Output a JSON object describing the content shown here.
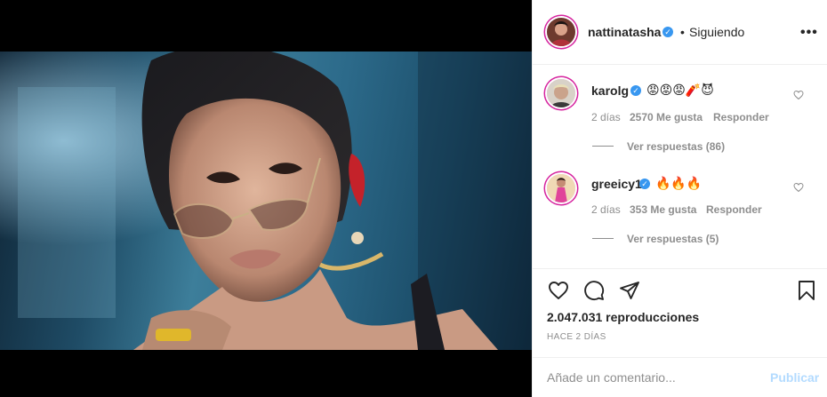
{
  "post": {
    "author": "nattinatasha",
    "follow_separator": "•",
    "follow_status": "Siguiendo",
    "more_label": "•••",
    "verified_mark": "✓"
  },
  "comments": [
    {
      "username": "karolg",
      "text": "😡😡😡🧨😈",
      "time": "2 días",
      "likes": "2570 Me gusta",
      "reply_label": "Responder",
      "view_replies": "Ver respuestas (86)"
    },
    {
      "username": "greeicy1",
      "text": "🔥🔥🔥",
      "time": "2 días",
      "likes": "353 Me gusta",
      "reply_label": "Responder",
      "view_replies": "Ver respuestas (5)"
    }
  ],
  "actions": {
    "icons": [
      "heart-icon",
      "comment-icon",
      "share-icon",
      "bookmark-icon"
    ],
    "views": "2.047.031 reproducciones",
    "time_ago": "HACE 2 DÍAS"
  },
  "comment_box": {
    "placeholder": "Añade un comentario...",
    "publish_label": "Publicar"
  },
  "colors": {
    "verified": "#3897f0",
    "publish_disabled": "#b3dbff",
    "muted_text": "#8e8e8e",
    "story_ring": "#d6249f"
  }
}
